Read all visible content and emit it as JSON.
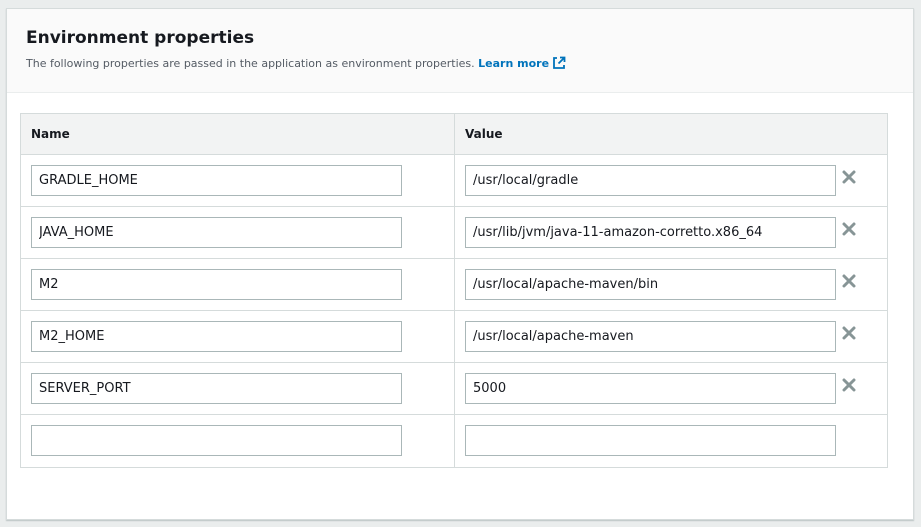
{
  "section": {
    "title": "Environment properties",
    "description": "The following properties are passed in the application as environment properties.",
    "learn_more": "Learn more"
  },
  "table": {
    "headers": {
      "name": "Name",
      "value": "Value"
    },
    "rows": [
      {
        "name": "GRADLE_HOME",
        "value": "/usr/local/gradle"
      },
      {
        "name": "JAVA_HOME",
        "value": "/usr/lib/jvm/java-11-amazon-corretto.x86_64"
      },
      {
        "name": "M2",
        "value": "/usr/local/apache-maven/bin"
      },
      {
        "name": "M2_HOME",
        "value": "/usr/local/apache-maven"
      },
      {
        "name": "SERVER_PORT",
        "value": "5000"
      },
      {
        "name": "",
        "value": ""
      }
    ]
  },
  "icons": {
    "external": "external-link-icon",
    "remove": "close-icon"
  },
  "colors": {
    "link": "#0073bb",
    "remove_icon": "#879596"
  }
}
